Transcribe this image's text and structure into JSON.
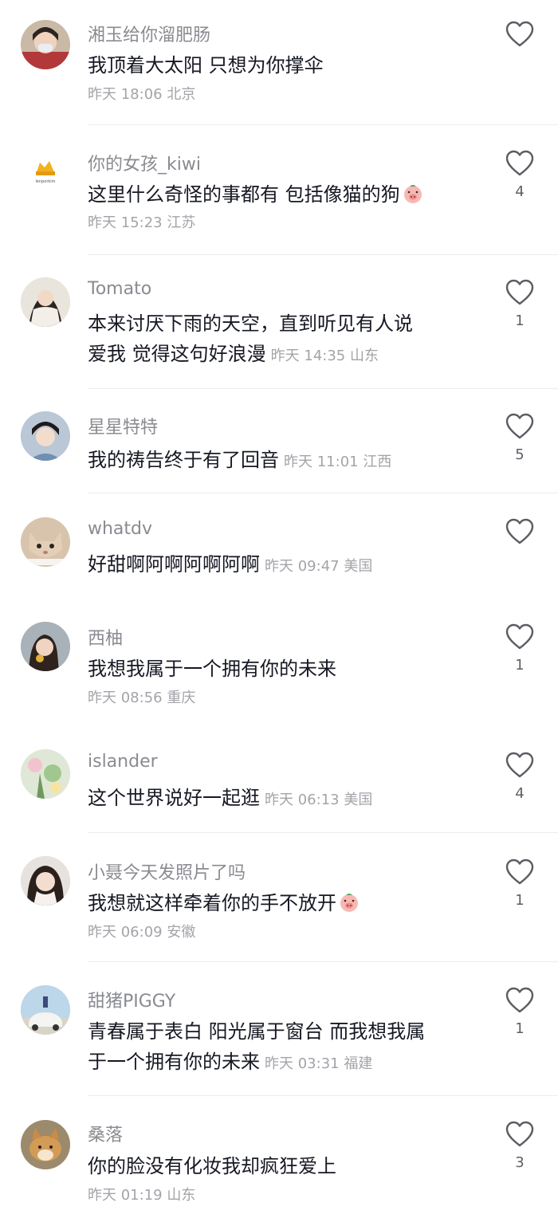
{
  "comments": [
    {
      "username": "湘玉给你溜肥肠",
      "lines": [
        "我顶着大太阳 只想为你撑伞"
      ],
      "meta": "昨天 18:06 北京",
      "meta_inline": false,
      "likes": "",
      "avatar": "person-mask"
    },
    {
      "username": "你的女孩_kiwi",
      "lines": [
        "这里什么奇怪的事都有 包括像猫的狗"
      ],
      "meta": "昨天 15:23 江苏",
      "meta_inline": false,
      "likes": "4",
      "avatar": "logo",
      "emoji": "pig-face-emoji"
    },
    {
      "username": "Tomato",
      "lines": [
        "本来讨厌下雨的天空，直到听见有人说",
        "爱我  觉得这句好浪漫"
      ],
      "meta": "昨天 14:35 山东",
      "meta_inline": true,
      "likes": "1",
      "avatar": "person-hair"
    },
    {
      "username": "星星特特",
      "lines": [
        "我的祷告终于有了回音"
      ],
      "meta": "昨天 11:01 江西",
      "meta_inline": true,
      "likes": "5",
      "avatar": "person-boy"
    },
    {
      "username": "whatdv",
      "lines": [
        "好甜啊阿啊阿啊阿啊"
      ],
      "meta": "昨天 09:47 美国",
      "meta_inline": true,
      "likes": "",
      "avatar": "cat"
    },
    {
      "username": "西柚",
      "lines": [
        "我想我属于一个拥有你的未来"
      ],
      "meta": "昨天 08:56 重庆",
      "meta_inline": false,
      "likes": "1",
      "avatar": "person-girl"
    },
    {
      "username": "islander",
      "lines": [
        "这个世界说好一起逛"
      ],
      "meta": "昨天 06:13 美国",
      "meta_inline": true,
      "likes": "4",
      "avatar": "flowers"
    },
    {
      "username": "小聂今天发照片了吗",
      "lines": [
        "我想就这样牵着你的手不放开"
      ],
      "meta": "昨天 06:09 安徽",
      "meta_inline": false,
      "likes": "1",
      "avatar": "person-selfie",
      "emoji": "pig-face-emoji"
    },
    {
      "username": "甜猪PIGGY",
      "lines": [
        "青春属于表白 阳光属于窗台  而我想我属",
        "于一个拥有你的未来"
      ],
      "meta": "昨天 03:31 福建",
      "meta_inline": true,
      "likes": "1",
      "avatar": "car"
    },
    {
      "username": "桑落",
      "lines": [
        "你的脸没有化妆我却疯狂爱上"
      ],
      "meta": "昨天 01:19 山东",
      "meta_inline": false,
      "likes": "3",
      "avatar": "dog"
    }
  ]
}
